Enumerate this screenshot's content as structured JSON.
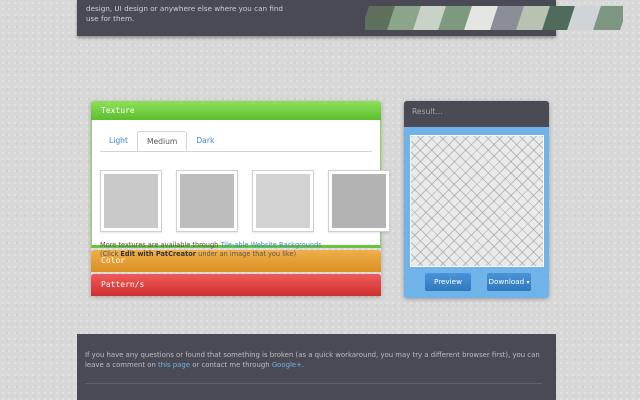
{
  "top": {
    "intro": "design, UI design or anywhere else where you can find use for them.",
    "strip_colors": [
      "#5e6f5c",
      "#8aa58a",
      "#c9d2c6",
      "#7d9a7f",
      "#e4e7e1",
      "#8a8f97",
      "#b7c2b3",
      "#4f6b5c",
      "#cfd4d6",
      "#7c9682"
    ]
  },
  "accordion": {
    "textures_title": "Texture",
    "tabs": [
      {
        "label": "Light"
      },
      {
        "label": "Medium"
      },
      {
        "label": "Dark"
      }
    ],
    "thumbs": [
      {
        "color": "#c9c9c9"
      },
      {
        "color": "#bdbdbd"
      },
      {
        "color": "#d2d2d2"
      },
      {
        "color": "#b3b3b3"
      }
    ],
    "note_prefix": "More textures are available through",
    "note_link": "Tile-able Website Backgrounds",
    "note_click": "(Click",
    "note_bold": "Edit with PatCreator",
    "note_suffix": "under an image that you like)",
    "color_title": "Color",
    "patterns_title": "Pattern/s"
  },
  "result": {
    "title": "Result...",
    "preview_label": "Preview",
    "download_label": "Download",
    "caret": "▾"
  },
  "footer": {
    "text_1": "If you have any questions or found that something is broken (as a quick workaround, you may try a different browser first), you can leave a comment on",
    "link_1": "this page",
    "text_2": "or contact me through",
    "link_2": "Google+",
    "text_3": "."
  }
}
